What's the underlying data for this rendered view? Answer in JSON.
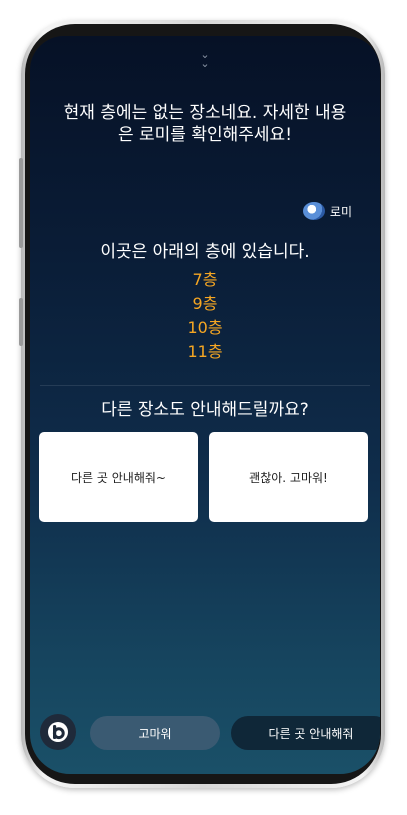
{
  "handle": {
    "icon": "double-chevron-down-icon",
    "glyph": "⌄"
  },
  "message": {
    "line1": "현재 층에는 없는 장소네요. 자세한 내용",
    "line2": "은 로미를 확인해주세요!"
  },
  "speaker": {
    "name": "로미",
    "icon": "robot-avatar-icon"
  },
  "answer": {
    "title": "이곳은 아래의 층에 있습니다.",
    "floors": [
      "7층",
      "9층",
      "10층",
      "11층"
    ],
    "floor_color": "#f5a623"
  },
  "question": "다른 장소도 안내해드릴까요?",
  "cards": {
    "left": "다른 곳 안내해줘~",
    "right": "괜찮아. 고마워!"
  },
  "bottom": {
    "assistant_icon": "bixby-icon",
    "chips": [
      "고마워",
      "다른 곳 안내해줘"
    ]
  }
}
